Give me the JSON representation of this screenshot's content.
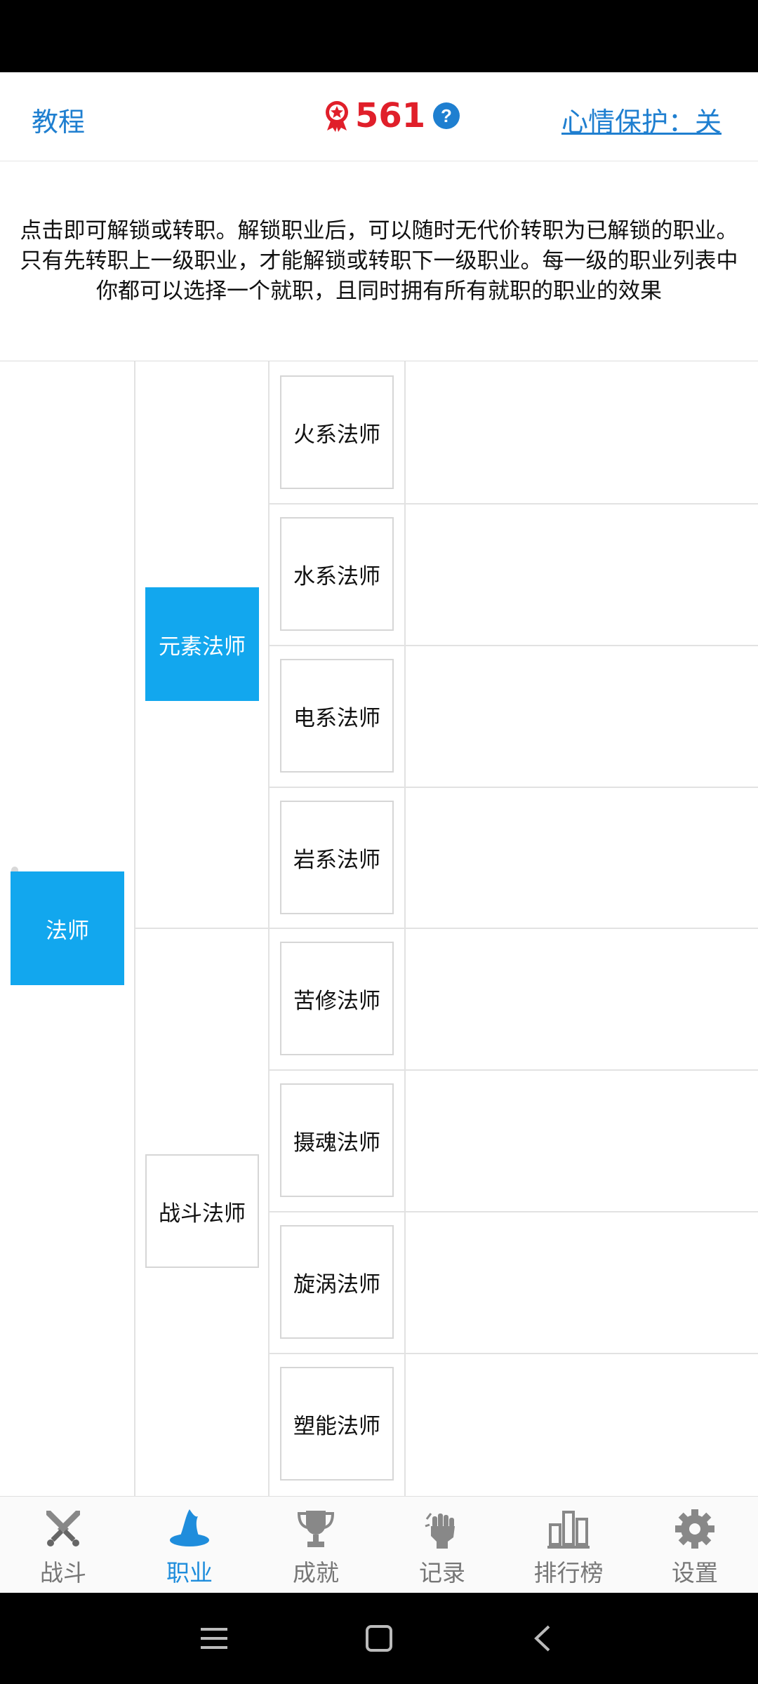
{
  "header": {
    "tutorial_label": "教程",
    "points": "561",
    "mood_protect_label": "心情保护：关",
    "badge_icon": "award-medal-icon",
    "help_icon": "question-circle-icon"
  },
  "info_text": "点击即可解锁或转职。解锁职业后，可以随时无代价转职为已解锁的职业。只有先转职上一级职业，才能解锁或转职下一级职业。每一级的职业列表中你都可以选择一个就职，且同时拥有所有就职的职业的效果",
  "tree": {
    "level1": [
      {
        "label": "法师",
        "active": true
      }
    ],
    "level2": [
      {
        "label": "元素法师",
        "active": true
      },
      {
        "label": "战斗法师",
        "active": false
      }
    ],
    "level3": [
      {
        "label": "火系法师"
      },
      {
        "label": "水系法师"
      },
      {
        "label": "电系法师"
      },
      {
        "label": "岩系法师"
      },
      {
        "label": "苦修法师"
      },
      {
        "label": "摄魂法师"
      },
      {
        "label": "旋涡法师"
      },
      {
        "label": "塑能法师"
      }
    ]
  },
  "nav": [
    {
      "label": "战斗",
      "icon": "crossed-swords-icon",
      "active": false
    },
    {
      "label": "职业",
      "icon": "wizard-hat-icon",
      "active": true
    },
    {
      "label": "成就",
      "icon": "trophy-icon",
      "active": false
    },
    {
      "label": "记录",
      "icon": "raised-fist-icon",
      "active": false
    },
    {
      "label": "排行榜",
      "icon": "bar-chart-icon",
      "active": false
    },
    {
      "label": "设置",
      "icon": "gear-icon",
      "active": false
    }
  ],
  "colors": {
    "accent": "#1f7fd0",
    "active_node": "#12a7ee",
    "points": "#e01f2a",
    "nav_active": "#1f8ddc",
    "nav_inactive": "#777777"
  }
}
